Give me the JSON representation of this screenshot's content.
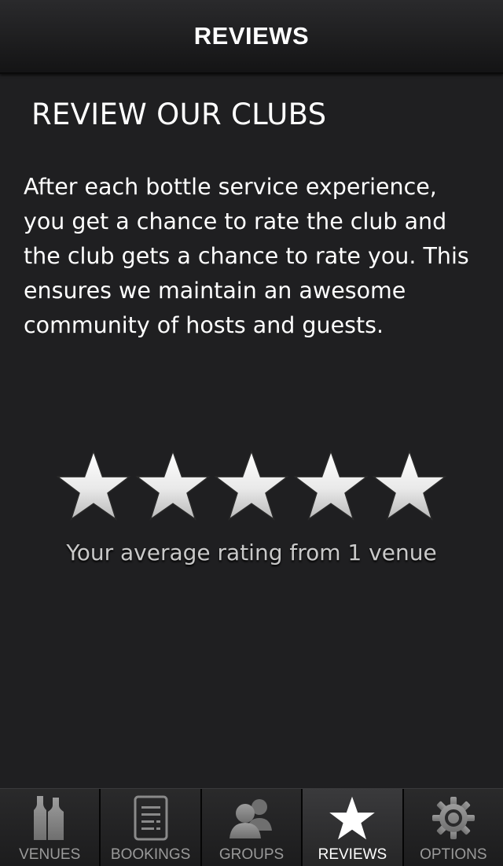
{
  "nav": {
    "title": "REVIEWS"
  },
  "main": {
    "section_title": "REVIEW OUR CLUBS",
    "description": "After each bottle service experience, you get a chance to rate the club and the club gets a chance to rate you. This ensures we maintain an awesome community of hosts and guests.",
    "rating": {
      "value": 5,
      "max": 5,
      "caption": "Your average rating from 1 venue"
    }
  },
  "tabs": [
    {
      "label": "VENUES",
      "icon": "bottles-icon",
      "active": false
    },
    {
      "label": "BOOKINGS",
      "icon": "document-icon",
      "active": false
    },
    {
      "label": "GROUPS",
      "icon": "people-icon",
      "active": false
    },
    {
      "label": "REVIEWS",
      "icon": "star-icon",
      "active": true
    },
    {
      "label": "OPTIONS",
      "icon": "gear-icon",
      "active": false
    }
  ],
  "colors": {
    "background": "#1f1f21",
    "tab_inactive": "#9a9a9a",
    "tab_active": "#ffffff"
  }
}
